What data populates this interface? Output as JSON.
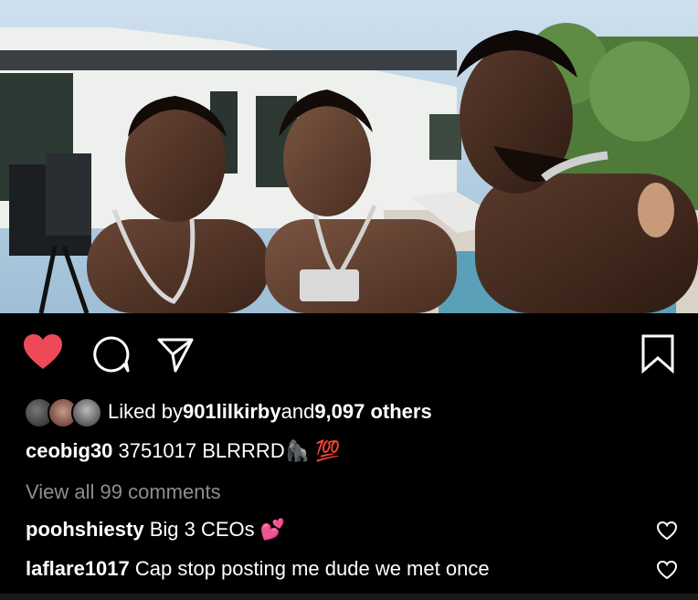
{
  "post": {
    "photo_alt": "three men by a pool",
    "liked": true,
    "likes": {
      "prefix": "Liked by ",
      "user": "901lilkirby",
      "middle": " and ",
      "others": "9,097 others"
    },
    "caption": {
      "username": "ceobig30",
      "text": " 3751017 BLRRRD",
      "emoji_1": "🦍",
      "emoji_2": "💯"
    },
    "view_comments": "View all 99 comments",
    "comments": [
      {
        "username": "poohshiesty",
        "text": " Big 3 CEOs ",
        "emoji": "💕"
      },
      {
        "username": "laflare1017",
        "text": " Cap stop posting me dude we met once",
        "emoji": ""
      }
    ]
  },
  "colors": {
    "like_red": "#ed4956",
    "muted": "#8e8e8e",
    "background": "#000000"
  },
  "icons": [
    "heart-icon",
    "comment-icon",
    "share-icon",
    "bookmark-icon",
    "comment-like-icon"
  ]
}
